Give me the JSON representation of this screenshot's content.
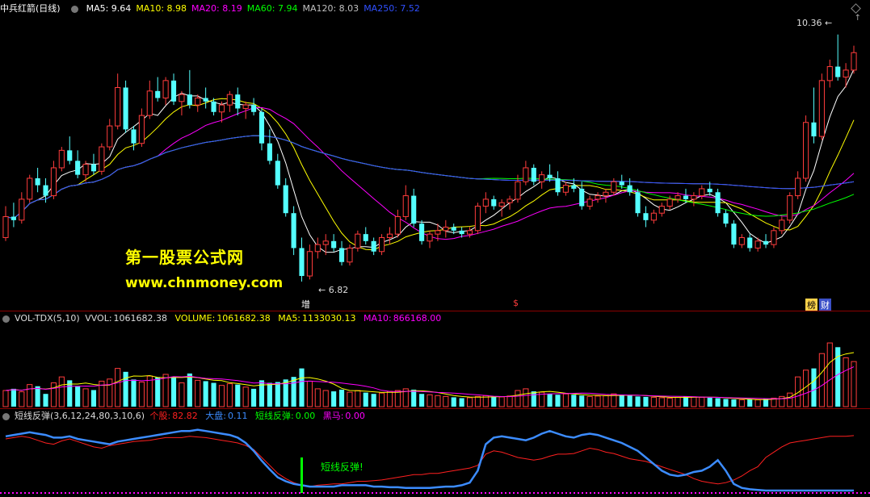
{
  "header": {
    "stock_name": "中兵红箭",
    "period": "(日线)",
    "ma": [
      {
        "label": "MA5:",
        "value": "9.64",
        "color": "#ffffff"
      },
      {
        "label": "MA10:",
        "value": "8.98",
        "color": "#ffff00"
      },
      {
        "label": "MA20:",
        "value": "8.19",
        "color": "#ff00ff"
      },
      {
        "label": "MA60:",
        "value": "7.94",
        "color": "#00ff00"
      },
      {
        "label": "MA120:",
        "value": "8.03",
        "color": "#c0c0c0"
      },
      {
        "label": "MA250:",
        "value": "7.52",
        "color": "#3050ff"
      }
    ]
  },
  "watermark": {
    "line1": "第一股票公式网",
    "line2": "www.chnmoney.com"
  },
  "annotations": {
    "high": "10.36",
    "low": "6.82"
  },
  "badges": {
    "zeng": "增",
    "s": "$",
    "bang": "榜",
    "cai": "财"
  },
  "volume_header": {
    "name": "VOL-TDX(5,10)",
    "vvol_label": "VVOL:",
    "vvol": "1061682.38",
    "volume_label": "VOLUME:",
    "volume": "1061682.38",
    "ma5_label": "MA5:",
    "ma5": "1133030.13",
    "ma10_label": "MA10:",
    "ma10": "866168.00"
  },
  "indicator_header": {
    "name": "短线反弹(3,6,12,24,80,3,10,6)",
    "gegu_label": "个股:",
    "gegu": "82.82",
    "dapan_label": "大盘:",
    "dapan": "0.11",
    "fantan_label": "短线反弹:",
    "fantan": "0.00",
    "heima_label": "黑马:",
    "heima": "0.00"
  },
  "signal_label": "短线反弹!",
  "colors": {
    "up": "#ff3c3c",
    "down": "#54ffff",
    "gegu": "#ff2020",
    "dapan": "#3c8cff",
    "fantan": "#00ff00",
    "heima": "#ff00ff"
  },
  "chart_data": {
    "type": "candlestick",
    "price_range": [
      6.6,
      10.6
    ],
    "candles": [
      {
        "o": 7.45,
        "h": 7.9,
        "l": 7.4,
        "c": 7.75
      },
      {
        "o": 7.75,
        "h": 7.95,
        "l": 7.6,
        "c": 7.7
      },
      {
        "o": 7.7,
        "h": 8.1,
        "l": 7.65,
        "c": 8.0
      },
      {
        "o": 8.0,
        "h": 8.35,
        "l": 7.95,
        "c": 8.3
      },
      {
        "o": 8.3,
        "h": 8.45,
        "l": 8.1,
        "c": 8.2
      },
      {
        "o": 8.2,
        "h": 8.3,
        "l": 7.95,
        "c": 8.05
      },
      {
        "o": 8.05,
        "h": 8.55,
        "l": 8.0,
        "c": 8.45
      },
      {
        "o": 8.45,
        "h": 8.75,
        "l": 8.4,
        "c": 8.7
      },
      {
        "o": 8.7,
        "h": 8.9,
        "l": 8.5,
        "c": 8.55
      },
      {
        "o": 8.55,
        "h": 8.7,
        "l": 8.3,
        "c": 8.35
      },
      {
        "o": 8.35,
        "h": 8.55,
        "l": 8.25,
        "c": 8.5
      },
      {
        "o": 8.5,
        "h": 8.65,
        "l": 8.35,
        "c": 8.4
      },
      {
        "o": 8.4,
        "h": 8.8,
        "l": 8.35,
        "c": 8.75
      },
      {
        "o": 8.75,
        "h": 9.15,
        "l": 8.7,
        "c": 9.05
      },
      {
        "o": 9.05,
        "h": 9.8,
        "l": 9.0,
        "c": 9.6
      },
      {
        "o": 9.6,
        "h": 9.7,
        "l": 8.95,
        "c": 9.0
      },
      {
        "o": 9.0,
        "h": 9.05,
        "l": 8.7,
        "c": 8.8
      },
      {
        "o": 8.8,
        "h": 9.3,
        "l": 8.75,
        "c": 9.2
      },
      {
        "o": 9.2,
        "h": 9.7,
        "l": 9.15,
        "c": 9.55
      },
      {
        "o": 9.55,
        "h": 9.75,
        "l": 9.4,
        "c": 9.45
      },
      {
        "o": 9.45,
        "h": 9.75,
        "l": 9.35,
        "c": 9.7
      },
      {
        "o": 9.7,
        "h": 9.8,
        "l": 9.35,
        "c": 9.4
      },
      {
        "o": 9.4,
        "h": 9.55,
        "l": 9.2,
        "c": 9.5
      },
      {
        "o": 9.5,
        "h": 9.85,
        "l": 9.3,
        "c": 9.35
      },
      {
        "o": 9.35,
        "h": 9.5,
        "l": 9.25,
        "c": 9.45
      },
      {
        "o": 9.45,
        "h": 9.6,
        "l": 9.3,
        "c": 9.4
      },
      {
        "o": 9.4,
        "h": 9.45,
        "l": 9.2,
        "c": 9.25
      },
      {
        "o": 9.25,
        "h": 9.4,
        "l": 9.1,
        "c": 9.35
      },
      {
        "o": 9.35,
        "h": 9.55,
        "l": 9.25,
        "c": 9.5
      },
      {
        "o": 9.5,
        "h": 9.6,
        "l": 9.2,
        "c": 9.3
      },
      {
        "o": 9.3,
        "h": 9.4,
        "l": 9.15,
        "c": 9.35
      },
      {
        "o": 9.35,
        "h": 9.45,
        "l": 9.2,
        "c": 9.25
      },
      {
        "o": 9.25,
        "h": 9.3,
        "l": 8.7,
        "c": 8.8
      },
      {
        "o": 8.8,
        "h": 9.0,
        "l": 8.5,
        "c": 8.55
      },
      {
        "o": 8.55,
        "h": 8.65,
        "l": 8.15,
        "c": 8.2
      },
      {
        "o": 8.2,
        "h": 8.3,
        "l": 7.75,
        "c": 7.8
      },
      {
        "o": 7.8,
        "h": 7.9,
        "l": 7.2,
        "c": 7.3
      },
      {
        "o": 7.3,
        "h": 7.45,
        "l": 6.82,
        "c": 6.9
      },
      {
        "o": 6.9,
        "h": 7.35,
        "l": 6.85,
        "c": 7.25
      },
      {
        "o": 7.25,
        "h": 7.45,
        "l": 7.15,
        "c": 7.35
      },
      {
        "o": 7.35,
        "h": 7.5,
        "l": 7.2,
        "c": 7.4
      },
      {
        "o": 7.4,
        "h": 7.5,
        "l": 7.25,
        "c": 7.3
      },
      {
        "o": 7.3,
        "h": 7.4,
        "l": 7.05,
        "c": 7.1
      },
      {
        "o": 7.1,
        "h": 7.35,
        "l": 7.05,
        "c": 7.3
      },
      {
        "o": 7.3,
        "h": 7.55,
        "l": 7.25,
        "c": 7.5
      },
      {
        "o": 7.5,
        "h": 7.6,
        "l": 7.35,
        "c": 7.4
      },
      {
        "o": 7.4,
        "h": 7.45,
        "l": 7.2,
        "c": 7.25
      },
      {
        "o": 7.25,
        "h": 7.5,
        "l": 7.2,
        "c": 7.45
      },
      {
        "o": 7.45,
        "h": 7.6,
        "l": 7.35,
        "c": 7.5
      },
      {
        "o": 7.5,
        "h": 7.85,
        "l": 7.45,
        "c": 7.75
      },
      {
        "o": 7.75,
        "h": 8.2,
        "l": 7.7,
        "c": 8.05
      },
      {
        "o": 8.05,
        "h": 8.15,
        "l": 7.6,
        "c": 7.65
      },
      {
        "o": 7.65,
        "h": 7.7,
        "l": 7.35,
        "c": 7.4
      },
      {
        "o": 7.4,
        "h": 7.55,
        "l": 7.3,
        "c": 7.5
      },
      {
        "o": 7.5,
        "h": 7.65,
        "l": 7.4,
        "c": 7.55
      },
      {
        "o": 7.55,
        "h": 7.7,
        "l": 7.45,
        "c": 7.6
      },
      {
        "o": 7.6,
        "h": 7.65,
        "l": 7.5,
        "c": 7.55
      },
      {
        "o": 7.55,
        "h": 7.6,
        "l": 7.45,
        "c": 7.5
      },
      {
        "o": 7.5,
        "h": 7.6,
        "l": 7.45,
        "c": 7.55
      },
      {
        "o": 7.55,
        "h": 7.95,
        "l": 7.5,
        "c": 7.9
      },
      {
        "o": 7.9,
        "h": 8.1,
        "l": 7.8,
        "c": 8.0
      },
      {
        "o": 8.0,
        "h": 8.05,
        "l": 7.85,
        "c": 7.9
      },
      {
        "o": 7.9,
        "h": 8.0,
        "l": 7.75,
        "c": 7.95
      },
      {
        "o": 7.95,
        "h": 8.05,
        "l": 7.85,
        "c": 8.0
      },
      {
        "o": 8.0,
        "h": 8.35,
        "l": 7.95,
        "c": 8.25
      },
      {
        "o": 8.25,
        "h": 8.55,
        "l": 8.2,
        "c": 8.45
      },
      {
        "o": 8.45,
        "h": 8.5,
        "l": 8.2,
        "c": 8.25
      },
      {
        "o": 8.25,
        "h": 8.4,
        "l": 8.15,
        "c": 8.35
      },
      {
        "o": 8.35,
        "h": 8.5,
        "l": 8.25,
        "c": 8.3
      },
      {
        "o": 8.3,
        "h": 8.4,
        "l": 8.05,
        "c": 8.1
      },
      {
        "o": 8.1,
        "h": 8.25,
        "l": 8.05,
        "c": 8.2
      },
      {
        "o": 8.2,
        "h": 8.3,
        "l": 8.1,
        "c": 8.15
      },
      {
        "o": 8.15,
        "h": 8.25,
        "l": 7.85,
        "c": 7.9
      },
      {
        "o": 7.9,
        "h": 8.05,
        "l": 7.85,
        "c": 8.0
      },
      {
        "o": 8.0,
        "h": 8.1,
        "l": 7.95,
        "c": 8.05
      },
      {
        "o": 8.05,
        "h": 8.15,
        "l": 7.95,
        "c": 8.1
      },
      {
        "o": 8.1,
        "h": 8.3,
        "l": 8.05,
        "c": 8.25
      },
      {
        "o": 8.25,
        "h": 8.35,
        "l": 8.15,
        "c": 8.2
      },
      {
        "o": 8.2,
        "h": 8.3,
        "l": 8.05,
        "c": 8.1
      },
      {
        "o": 8.1,
        "h": 8.15,
        "l": 7.75,
        "c": 7.8
      },
      {
        "o": 7.8,
        "h": 7.9,
        "l": 7.6,
        "c": 7.7
      },
      {
        "o": 7.7,
        "h": 7.85,
        "l": 7.65,
        "c": 7.8
      },
      {
        "o": 7.8,
        "h": 7.95,
        "l": 7.75,
        "c": 7.9
      },
      {
        "o": 7.9,
        "h": 8.05,
        "l": 7.85,
        "c": 8.0
      },
      {
        "o": 8.0,
        "h": 8.1,
        "l": 7.95,
        "c": 8.05
      },
      {
        "o": 8.05,
        "h": 8.15,
        "l": 7.95,
        "c": 8.0
      },
      {
        "o": 8.0,
        "h": 8.1,
        "l": 7.9,
        "c": 8.05
      },
      {
        "o": 8.05,
        "h": 8.2,
        "l": 8.0,
        "c": 8.15
      },
      {
        "o": 8.15,
        "h": 8.25,
        "l": 8.05,
        "c": 8.1
      },
      {
        "o": 8.1,
        "h": 8.15,
        "l": 7.75,
        "c": 7.8
      },
      {
        "o": 7.8,
        "h": 7.85,
        "l": 7.6,
        "c": 7.65
      },
      {
        "o": 7.65,
        "h": 7.7,
        "l": 7.3,
        "c": 7.35
      },
      {
        "o": 7.35,
        "h": 7.5,
        "l": 7.3,
        "c": 7.45
      },
      {
        "o": 7.45,
        "h": 7.5,
        "l": 7.25,
        "c": 7.3
      },
      {
        "o": 7.3,
        "h": 7.45,
        "l": 7.25,
        "c": 7.4
      },
      {
        "o": 7.4,
        "h": 7.5,
        "l": 7.3,
        "c": 7.35
      },
      {
        "o": 7.35,
        "h": 7.6,
        "l": 7.3,
        "c": 7.55
      },
      {
        "o": 7.55,
        "h": 7.75,
        "l": 7.5,
        "c": 7.7
      },
      {
        "o": 7.7,
        "h": 8.1,
        "l": 7.65,
        "c": 8.05
      },
      {
        "o": 8.05,
        "h": 8.4,
        "l": 8.0,
        "c": 8.3
      },
      {
        "o": 8.3,
        "h": 9.2,
        "l": 8.25,
        "c": 9.1
      },
      {
        "o": 9.1,
        "h": 9.6,
        "l": 8.8,
        "c": 8.9
      },
      {
        "o": 8.9,
        "h": 9.8,
        "l": 8.85,
        "c": 9.7
      },
      {
        "o": 9.7,
        "h": 10.0,
        "l": 9.6,
        "c": 9.9
      },
      {
        "o": 9.9,
        "h": 10.36,
        "l": 9.7,
        "c": 9.75
      },
      {
        "o": 9.75,
        "h": 9.95,
        "l": 9.6,
        "c": 9.85
      },
      {
        "o": 9.85,
        "h": 10.2,
        "l": 9.8,
        "c": 10.1
      }
    ],
    "volume_max": 1900000,
    "volumes": [
      380000,
      420000,
      350000,
      520000,
      480000,
      300000,
      560000,
      700000,
      620000,
      480000,
      420000,
      390000,
      600000,
      650000,
      900000,
      820000,
      640000,
      580000,
      720000,
      690000,
      760000,
      700000,
      560000,
      780000,
      620000,
      600000,
      560000,
      500000,
      540000,
      520000,
      460000,
      420000,
      620000,
      560000,
      580000,
      640000,
      700000,
      900000,
      600000,
      420000,
      380000,
      360000,
      400000,
      340000,
      380000,
      330000,
      300000,
      320000,
      360000,
      380000,
      420000,
      400000,
      300000,
      280000,
      260000,
      240000,
      220000,
      200000,
      210000,
      240000,
      260000,
      240000,
      230000,
      250000,
      380000,
      420000,
      360000,
      340000,
      300000,
      280000,
      300000,
      280000,
      260000,
      240000,
      250000,
      260000,
      300000,
      280000,
      260000,
      240000,
      230000,
      220000,
      210000,
      200000,
      220000,
      240000,
      230000,
      220000,
      210000,
      200000,
      180000,
      170000,
      160000,
      170000,
      160000,
      180000,
      200000,
      240000,
      320000,
      700000,
      860000,
      900000,
      1250000,
      1500000,
      1400000,
      1150000,
      1061682
    ],
    "indicator_range": [
      0,
      100
    ],
    "gegu": [
      78,
      80,
      82,
      80,
      76,
      72,
      70,
      75,
      78,
      74,
      70,
      66,
      64,
      68,
      70,
      72,
      74,
      75,
      76,
      78,
      80,
      80,
      80,
      82,
      81,
      80,
      78,
      76,
      74,
      72,
      68,
      62,
      50,
      38,
      26,
      18,
      12,
      8,
      6,
      8,
      9,
      10,
      10,
      12,
      14,
      14,
      15,
      16,
      18,
      20,
      22,
      24,
      24,
      26,
      26,
      28,
      30,
      32,
      34,
      38,
      55,
      60,
      58,
      54,
      50,
      48,
      46,
      48,
      52,
      55,
      55,
      56,
      60,
      64,
      62,
      58,
      56,
      52,
      48,
      46,
      44,
      40,
      36,
      32,
      28,
      24,
      18,
      14,
      12,
      10,
      12,
      16,
      22,
      30,
      36,
      50,
      58,
      66,
      72,
      74,
      76,
      78,
      80,
      82,
      82,
      82,
      83
    ],
    "dapan": [
      82,
      84,
      86,
      88,
      86,
      84,
      80,
      80,
      82,
      78,
      76,
      74,
      72,
      70,
      74,
      76,
      78,
      80,
      82,
      84,
      86,
      88,
      90,
      90,
      92,
      90,
      88,
      86,
      84,
      80,
      72,
      60,
      45,
      32,
      20,
      14,
      10,
      8,
      6,
      6,
      6,
      6,
      8,
      8,
      8,
      8,
      6,
      6,
      5,
      5,
      4,
      4,
      4,
      4,
      5,
      6,
      6,
      8,
      12,
      30,
      70,
      80,
      82,
      80,
      78,
      76,
      80,
      86,
      90,
      86,
      82,
      80,
      84,
      86,
      84,
      80,
      76,
      72,
      66,
      60,
      50,
      40,
      30,
      24,
      22,
      24,
      28,
      30,
      36,
      46,
      30,
      10,
      4,
      2,
      1,
      0,
      0,
      0,
      0,
      0,
      0,
      0,
      0,
      0,
      0,
      0,
      0
    ],
    "signal_index": 37
  }
}
